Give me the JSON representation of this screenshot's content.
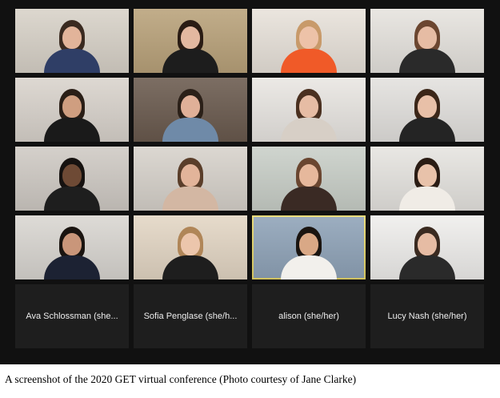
{
  "tiles": [
    {
      "bg": "#d8d2c8",
      "hair": "#3a2a20",
      "shirt": "#2f3e66",
      "skin": "#e2b49a"
    },
    {
      "bg": "#b9a27a",
      "hair": "#2a1c14",
      "shirt": "#1d1d1d",
      "skin": "#e3b8a0"
    },
    {
      "bg": "#e8e2da",
      "hair": "#c89a6a",
      "shirt": "#f05a28",
      "skin": "#edc2a8"
    },
    {
      "bg": "#e6e3de",
      "hair": "#6b4630",
      "shirt": "#2a2a2a",
      "skin": "#e6bca4"
    },
    {
      "bg": "#d9d3cc",
      "hair": "#2a1e16",
      "shirt": "#1a1a1a",
      "skin": "#cf9e80"
    },
    {
      "bg": "#6a5a4e",
      "hair": "#2b2018",
      "shirt": "#6f8aa8",
      "skin": "#e0b098"
    },
    {
      "bg": "#e9e6e2",
      "hair": "#4a3020",
      "shirt": "#d7cfc6",
      "skin": "#e6bca4"
    },
    {
      "bg": "#e3e1de",
      "hair": "#3b2618",
      "shirt": "#242424",
      "skin": "#e8c0a8"
    },
    {
      "bg": "#cfcac4",
      "hair": "#161210",
      "shirt": "#1e1e1e",
      "skin": "#6e4a35"
    },
    {
      "bg": "#d7d2cb",
      "hair": "#5a3e2a",
      "shirt": "#d3b7a3",
      "skin": "#e2b49a"
    },
    {
      "bg": "#c9cfc8",
      "hair": "#6a4630",
      "shirt": "#3a2a24",
      "skin": "#e6b89c"
    },
    {
      "bg": "#e6e4e0",
      "hair": "#2a1c14",
      "shirt": "#f0ece6",
      "skin": "#e8c2aa"
    },
    {
      "bg": "#d9d6d1",
      "hair": "#1a1410",
      "shirt": "#1c2233",
      "skin": "#c9967a"
    },
    {
      "bg": "#e3d6c4",
      "hair": "#b08658",
      "shirt": "#1e1e1e",
      "skin": "#ecc6ac"
    },
    {
      "bg": "#8fa3b8",
      "hair": "#1a1410",
      "shirt": "#f2f0ec",
      "skin": "#d9a886",
      "active": true
    },
    {
      "bg": "#efeeec",
      "hair": "#3a2a20",
      "shirt": "#2a2a2a",
      "skin": "#e6bca4"
    }
  ],
  "name_tiles": [
    {
      "label": "Ava Schlossman (she..."
    },
    {
      "label": "Sofia Penglase (she/h..."
    },
    {
      "label": "alison (she/her)"
    },
    {
      "label": "Lucy Nash (she/her)"
    }
  ],
  "caption": "A screenshot of the 2020 GET virtual conference (Photo courtesy of Jane Clarke)"
}
